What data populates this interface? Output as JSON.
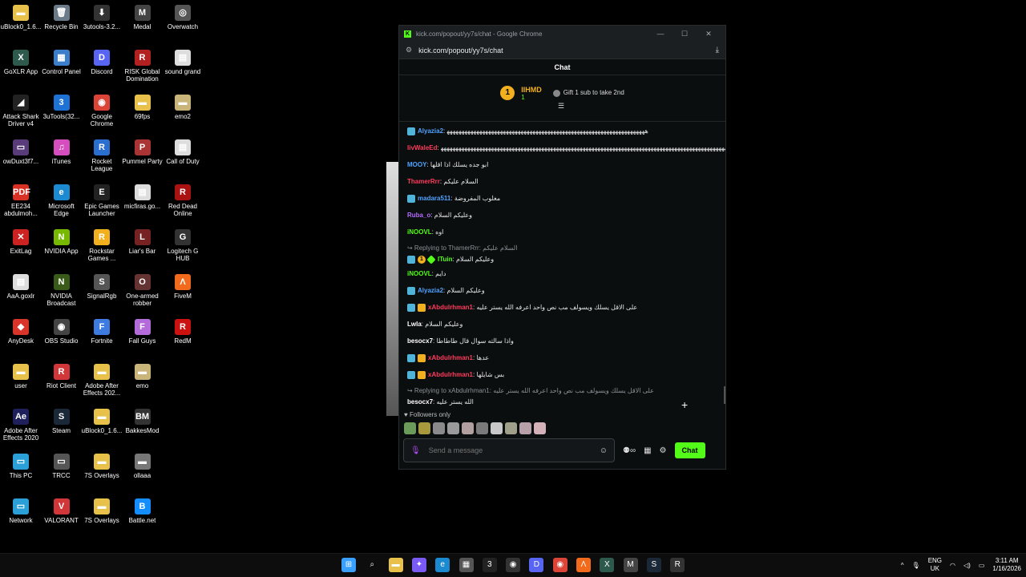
{
  "desktop_icons": [
    {
      "label": "uBlock0_1.6...",
      "glyph": "▬",
      "color": "#e8c14a"
    },
    {
      "label": "Recycle Bin",
      "glyph": "🗑",
      "color": "#6b7a88"
    },
    {
      "label": "3utools-3.2...",
      "glyph": "⬇",
      "color": "#333"
    },
    {
      "label": "Medal",
      "glyph": "M",
      "color": "#444"
    },
    {
      "label": "Overwatch",
      "glyph": "◎",
      "color": "#555"
    },
    {
      "label": "GoXLR App",
      "glyph": "X",
      "color": "#2e5a4e"
    },
    {
      "label": "Control Panel",
      "glyph": "▦",
      "color": "#3b7ec9"
    },
    {
      "label": "Discord",
      "glyph": "D",
      "color": "#5865f2"
    },
    {
      "label": "RISK Global Domination",
      "glyph": "R",
      "color": "#b32020"
    },
    {
      "label": "sound grand",
      "glyph": "▤",
      "color": "#ddd"
    },
    {
      "label": "Attack Shark Driver v4",
      "glyph": "◢",
      "color": "#222"
    },
    {
      "label": "3uTools(32...",
      "glyph": "3",
      "color": "#1e72d6"
    },
    {
      "label": "Google Chrome",
      "glyph": "◉",
      "color": "#db4437"
    },
    {
      "label": "69fps",
      "glyph": "▬",
      "color": "#e8c14a"
    },
    {
      "label": "emo2",
      "glyph": "▬",
      "color": "#c9b57a"
    },
    {
      "label": "owDuxt3f7...",
      "glyph": "▭",
      "color": "#5a3b7a"
    },
    {
      "label": "iTunes",
      "glyph": "♫",
      "color": "#d44fbd"
    },
    {
      "label": "Rocket League",
      "glyph": "R",
      "color": "#2a6fcf"
    },
    {
      "label": "Pummel Party",
      "glyph": "P",
      "color": "#a33"
    },
    {
      "label": "Call of Duty",
      "glyph": "▤",
      "color": "#ddd"
    },
    {
      "label": "EE234 abdulmoh...",
      "glyph": "PDF",
      "color": "#d93025"
    },
    {
      "label": "Microsoft Edge",
      "glyph": "e",
      "color": "#1b8ad1"
    },
    {
      "label": "Epic Games Launcher",
      "glyph": "E",
      "color": "#222"
    },
    {
      "label": "micfiras.go...",
      "glyph": "▤",
      "color": "#ddd"
    },
    {
      "label": "Red Dead Online",
      "glyph": "R",
      "color": "#a11"
    },
    {
      "label": "ExitLag",
      "glyph": "✕",
      "color": "#c22"
    },
    {
      "label": "NVIDIA App",
      "glyph": "N",
      "color": "#76b900"
    },
    {
      "label": "Rockstar Games ...",
      "glyph": "R",
      "color": "#f2b01e"
    },
    {
      "label": "Liar's Bar",
      "glyph": "L",
      "color": "#722"
    },
    {
      "label": "Logitech G HUB",
      "glyph": "G",
      "color": "#333"
    },
    {
      "label": "AaA.goxlr",
      "glyph": "▤",
      "color": "#ddd"
    },
    {
      "label": "NVIDIA Broadcast",
      "glyph": "N",
      "color": "#3a5a1a"
    },
    {
      "label": "SignalRgb",
      "glyph": "S",
      "color": "#555"
    },
    {
      "label": "One-armed robber",
      "glyph": "O",
      "color": "#633"
    },
    {
      "label": "FiveM",
      "glyph": "Λ",
      "color": "#f26a1b"
    },
    {
      "label": "AnyDesk",
      "glyph": "◆",
      "color": "#d8342a"
    },
    {
      "label": "OBS Studio",
      "glyph": "◉",
      "color": "#444"
    },
    {
      "label": "Fortnite",
      "glyph": "F",
      "color": "#3d7be0"
    },
    {
      "label": "Fall Guys",
      "glyph": "F",
      "color": "#b26bd8"
    },
    {
      "label": "RedM",
      "glyph": "R",
      "color": "#c11"
    },
    {
      "label": "user",
      "glyph": "▬",
      "color": "#e8c14a"
    },
    {
      "label": "Riot Client",
      "glyph": "R",
      "color": "#d13639"
    },
    {
      "label": "Adobe After Effects 202...",
      "glyph": "▬",
      "color": "#e8c14a"
    },
    {
      "label": "emo",
      "glyph": "▬",
      "color": "#c9b57a"
    },
    {
      "label": "",
      "glyph": "",
      "color": "transparent"
    },
    {
      "label": "Adobe After Effects 2020",
      "glyph": "Ae",
      "color": "#1f1f5c"
    },
    {
      "label": "Steam",
      "glyph": "S",
      "color": "#1b2838"
    },
    {
      "label": "uBlock0_1.6...",
      "glyph": "▬",
      "color": "#e8c14a"
    },
    {
      "label": "BakkesMod",
      "glyph": "BM",
      "color": "#333"
    },
    {
      "label": "",
      "glyph": "",
      "color": "transparent"
    },
    {
      "label": "This PC",
      "glyph": "▭",
      "color": "#2a9fd8"
    },
    {
      "label": "TRCC",
      "glyph": "▭",
      "color": "#555"
    },
    {
      "label": "7S Overlays",
      "glyph": "▬",
      "color": "#e8c14a"
    },
    {
      "label": "ollaaa",
      "glyph": "▬",
      "color": "#777"
    },
    {
      "label": "",
      "glyph": "",
      "color": "transparent"
    },
    {
      "label": "Network",
      "glyph": "▭",
      "color": "#2a9fd8"
    },
    {
      "label": "VALORANT",
      "glyph": "V",
      "color": "#d13639"
    },
    {
      "label": "7S Overlays",
      "glyph": "▬",
      "color": "#e8c14a"
    },
    {
      "label": "Battle.net",
      "glyph": "B",
      "color": "#148eff"
    }
  ],
  "browser": {
    "window_title": "kick.com/popout/yy7s/chat - Google Chrome",
    "favicon": "K",
    "url": "kick.com/popout/yy7s/chat",
    "controls": {
      "minimize": "—",
      "maximize": "☐",
      "close": "✕"
    }
  },
  "chat": {
    "header": "Chat",
    "leaderboard": {
      "rank": "1",
      "username": "IIHMD",
      "count": "1",
      "gift_text": "Gift 1 sub to take 2nd"
    },
    "messages": [
      {
        "badges": [
          "mod"
        ],
        "user": "Alyazia2",
        "color": "#4fa3ff",
        "text": "ﻫﻬﻬﻬﻬﻬﻬﻬﻬﻬﻬﻬﻬﻬﻬﻬﻬﻬﻬﻬﻬﻬﻬﻬﻬﻬﻬﻬﻬﻬﻬﻬﻬﻬﻬﻬﻬﻬﻬﻬﻬﻬﻬﻬﻬﻬﻬﻬﻬﻬﻬﻬﻬﻬﻬﻬﻬﻬﻬﻬﻬﻬﻬﻬﻬﻬﻬﻬ"
      },
      {
        "badges": [],
        "user": "livWaleEd",
        "color": "#ff3b5c",
        "text": "ﻫﻬﻬﻬﻬﻬﻬﻬﻬﻬﻬﻬﻬﻬﻬﻬﻬﻬﻬﻬﻬﻬﻬﻬﻬﻬﻬﻬﻬﻬﻬﻬﻬﻬﻬﻬﻬﻬﻬﻬﻬﻬﻬﻬﻬﻬﻬﻬﻬﻬﻬﻬﻬﻬﻬﻬﻬﻬﻬﻬﻬﻬﻬﻬﻬﻬﻬﻬﻬﻬﻬﻬﻬﻬﻬﻬﻬﻬﻬﻬﻬﻬﻬﻬﻬﻬﻬﻬﻬﻬﻬﻬﻬﻬﻬﻬﻬﻬﻬ"
      },
      {
        "badges": [],
        "user": "MOOY",
        "color": "#4fa3ff",
        "text": "ابو جده يسلك اذا اقلها"
      },
      {
        "badges": [],
        "user": "ThamerRrr",
        "color": "#ff3b5c",
        "text": "السلام عليكم"
      },
      {
        "badges": [
          "mod"
        ],
        "user": "madara511",
        "color": "#4fa3ff",
        "text": "مغلوب المفروضة"
      },
      {
        "badges": [],
        "user": "Ruba_o",
        "color": "#b56bff",
        "text": "وعليكم السلام"
      },
      {
        "badges": [],
        "user": "iNOOVL",
        "color": "#53fc18",
        "text": "اوه"
      },
      {
        "badges": [
          "mod",
          "gift",
          "star"
        ],
        "user": "ITuin",
        "color": "#53fc18",
        "text": "وعليكم السلام",
        "reply": "Replying to ThamerRrr: السلام عليكم"
      },
      {
        "badges": [],
        "user": "iNOOVL",
        "color": "#53fc18",
        "text": "دايم"
      },
      {
        "badges": [
          "mod"
        ],
        "user": "Alyazia2",
        "color": "#4fa3ff",
        "text": "وعليكم السلام"
      },
      {
        "badges": [
          "mod",
          "crown"
        ],
        "user": "xAbdulrhman1",
        "color": "#ff3b5c",
        "text": "على الاقل يسلك ويسولف مب نص واحد اعرفه الله يستر عليه"
      },
      {
        "badges": [],
        "user": "Lwla",
        "color": "#ffffff",
        "text": "وعليكم السلام"
      },
      {
        "badges": [],
        "user": "besocx7",
        "color": "#ffffff",
        "text": "واذا سالته سوال قال طاطاطا"
      },
      {
        "badges": [
          "mod",
          "crown"
        ],
        "user": "xAbdulrhman1",
        "color": "#ff3b5c",
        "text": "عدها"
      },
      {
        "badges": [
          "mod",
          "crown"
        ],
        "user": "xAbdulrhman1",
        "color": "#ff3b5c",
        "text": "بس شايلها"
      },
      {
        "badges": [],
        "user": "besocx7",
        "color": "#ffffff",
        "text": "الله يستر عليه",
        "reply": "Replying to xAbdulrhman1: على الاقل يسلك ويسولف مب نص واحد اعرفه الله يستر عليه"
      }
    ],
    "followers_only": "Followers only",
    "input_placeholder": "Send a message",
    "send_label": "Chat"
  },
  "taskbar": {
    "apps": [
      {
        "name": "start",
        "glyph": "⊞",
        "color": "#3aa0ff"
      },
      {
        "name": "search",
        "glyph": "⌕",
        "color": "transparent"
      },
      {
        "name": "explorer",
        "glyph": "▬",
        "color": "#e8c14a"
      },
      {
        "name": "copilot",
        "glyph": "✦",
        "color": "#7a5af5"
      },
      {
        "name": "edge",
        "glyph": "e",
        "color": "#1b8ad1"
      },
      {
        "name": "store",
        "glyph": "▦",
        "color": "#555"
      },
      {
        "name": "3utools",
        "glyph": "3",
        "color": "#222"
      },
      {
        "name": "obs",
        "glyph": "◉",
        "color": "#333"
      },
      {
        "name": "discord",
        "glyph": "D",
        "color": "#5865f2"
      },
      {
        "name": "chrome",
        "glyph": "◉",
        "color": "#db4437"
      },
      {
        "name": "fivem",
        "glyph": "Λ",
        "color": "#f26a1b"
      },
      {
        "name": "goxlr",
        "glyph": "X",
        "color": "#2e5a4e"
      },
      {
        "name": "medal",
        "glyph": "M",
        "color": "#444"
      },
      {
        "name": "steam",
        "glyph": "S",
        "color": "#1b2838"
      },
      {
        "name": "rockstar",
        "glyph": "R",
        "color": "#333"
      }
    ],
    "lang_top": "ENG",
    "lang_bottom": "UK",
    "time": "3:11 AM",
    "date": "1/16/2026"
  }
}
